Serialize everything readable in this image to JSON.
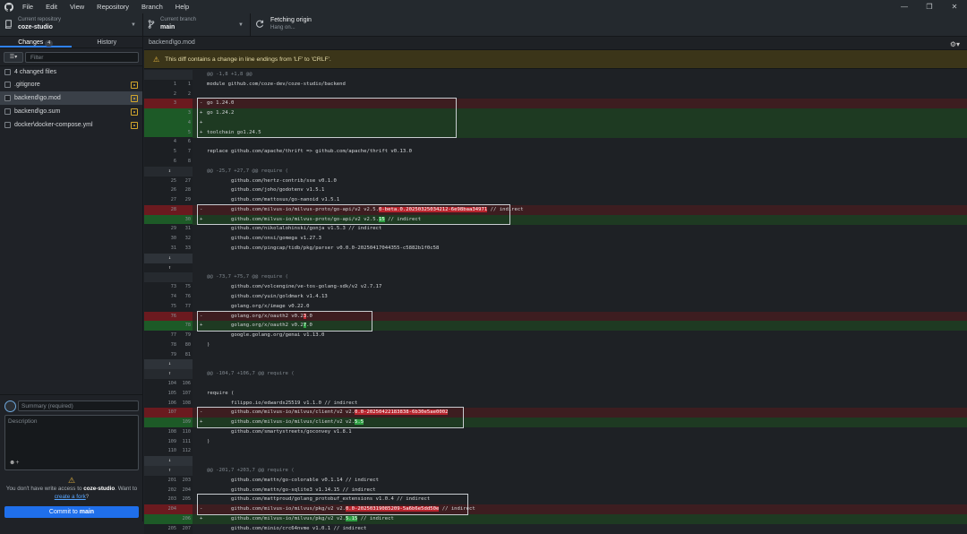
{
  "menu": [
    "File",
    "Edit",
    "View",
    "Repository",
    "Branch",
    "Help"
  ],
  "toolbar": {
    "repo_label": "Current repository",
    "repo_value": "coze-studio",
    "branch_label": "Current branch",
    "branch_value": "main",
    "fetch_label": "Fetching origin",
    "fetch_value": "Hang on..."
  },
  "sidebar": {
    "tab_changes": "Changes",
    "changes_count": "4",
    "tab_history": "History",
    "filter_placeholder": "Filter",
    "changed_files_label": "4 changed files",
    "files": [
      ".gitignore",
      "backend\\go.mod",
      "backend\\go.sum",
      "docker\\docker-compose.yml"
    ]
  },
  "commit": {
    "summary_placeholder": "Summary (required)",
    "description_placeholder": "Description",
    "warn_pre": "You don't have write access to ",
    "warn_repo": "coze-studio",
    "warn_mid": ". Want to ",
    "warn_link": "create a fork",
    "warn_post": "?",
    "button_pre": "Commit to ",
    "button_branch": "main"
  },
  "diff": {
    "path": "backend\\go.mod",
    "banner": "This diff contains a change in line endings from 'LF' to 'CRLF'.",
    "lines": [
      {
        "t": "hunk",
        "o": "",
        "n": "",
        "c": "@@ -1,8 +1,8 @@"
      },
      {
        "t": "ctx",
        "o": "1",
        "n": "1",
        "c": "module github.com/coze-dev/coze-studio/backend"
      },
      {
        "t": "ctx",
        "o": "2",
        "n": "2",
        "c": ""
      },
      {
        "t": "del",
        "o": "3",
        "n": "",
        "c": "go 1.24.0"
      },
      {
        "t": "add",
        "o": "",
        "n": "3",
        "c": "go 1.24.2"
      },
      {
        "t": "add",
        "o": "",
        "n": "4",
        "c": ""
      },
      {
        "t": "add",
        "o": "",
        "n": "5",
        "c": "toolchain go1.24.5"
      },
      {
        "t": "ctx",
        "o": "4",
        "n": "6",
        "c": ""
      },
      {
        "t": "ctx",
        "o": "5",
        "n": "7",
        "c": "replace github.com/apache/thrift => github.com/apache/thrift v0.13.0"
      },
      {
        "t": "ctx",
        "o": "6",
        "n": "8",
        "c": ""
      },
      {
        "t": "hunk",
        "o": "",
        "n": "",
        "c": "@@ -25,7 +27,7 @@ require (",
        "exp": "⇕"
      },
      {
        "t": "ctx",
        "o": "25",
        "n": "27",
        "c": "\tgithub.com/hertz-contrib/sse v0.1.0"
      },
      {
        "t": "ctx",
        "o": "26",
        "n": "28",
        "c": "\tgithub.com/joho/godotenv v1.5.1"
      },
      {
        "t": "ctx",
        "o": "27",
        "n": "29",
        "c": "\tgithub.com/mattosus/go-nanoid v1.5.1"
      },
      {
        "t": "del",
        "o": "28",
        "n": "",
        "c": "\tgithub.com/milvus-io/milvus-proto/go-api/v2 v2.5.",
        "h": "0-beta.0.20250325034212-6e98baa34971",
        "c2": " // indirect"
      },
      {
        "t": "add",
        "o": "",
        "n": "30",
        "c": "\tgithub.com/milvus-io/milvus-proto/go-api/v2 v2.5.",
        "h": "15",
        "c2": " // indirect"
      },
      {
        "t": "ctx",
        "o": "29",
        "n": "31",
        "c": "\tgithub.com/nikolalohinski/gonja v1.5.3 // indirect"
      },
      {
        "t": "ctx",
        "o": "30",
        "n": "32",
        "c": "\tgithub.com/onsi/gomega v1.27.3"
      },
      {
        "t": "ctx",
        "o": "31",
        "n": "33",
        "c": "\tgithub.com/pingcap/tidb/pkg/parser v0.0.0-20250417044355-c5882b1f0c58"
      },
      {
        "t": "exp",
        "o": "",
        "n": "",
        "c": "",
        "exp": "↓"
      },
      {
        "t": "blank",
        "o": "",
        "n": "",
        "c": "",
        "exp": "↑"
      },
      {
        "t": "hunk",
        "o": "",
        "n": "",
        "c": "@@ -73,7 +75,7 @@ require ("
      },
      {
        "t": "ctx",
        "o": "73",
        "n": "75",
        "c": "\tgithub.com/volcengine/ve-tos-golang-sdk/v2 v2.7.17"
      },
      {
        "t": "ctx",
        "o": "74",
        "n": "76",
        "c": "\tgithub.com/yuin/goldmark v1.4.13"
      },
      {
        "t": "ctx",
        "o": "75",
        "n": "77",
        "c": "\tgolang.org/x/image v0.22.0"
      },
      {
        "t": "del",
        "o": "76",
        "n": "",
        "c": "\tgolang.org/x/oauth2 v0.2",
        "h": "3",
        "c2": ".0"
      },
      {
        "t": "add",
        "o": "",
        "n": "78",
        "c": "\tgolang.org/x/oauth2 v0.2",
        "h": "7",
        "c2": ".0"
      },
      {
        "t": "ctx",
        "o": "77",
        "n": "79",
        "c": "\tgoogle.golang.org/genai v1.13.0"
      },
      {
        "t": "ctx",
        "o": "78",
        "n": "80",
        "c": ")"
      },
      {
        "t": "ctx",
        "o": "79",
        "n": "81",
        "c": ""
      },
      {
        "t": "exp",
        "o": "",
        "n": "",
        "c": "",
        "exp": "↓"
      },
      {
        "t": "hunk",
        "o": "",
        "n": "",
        "c": "@@ -104,7 +106,7 @@ require (",
        "exp": "↑"
      },
      {
        "t": "ctx",
        "o": "104",
        "n": "106",
        "c": ""
      },
      {
        "t": "ctx",
        "o": "105",
        "n": "107",
        "c": "require ("
      },
      {
        "t": "ctx",
        "o": "106",
        "n": "108",
        "c": "\tfilippo.io/edwards25519 v1.1.0 // indirect"
      },
      {
        "t": "del",
        "o": "107",
        "n": "",
        "c": "\tgithub.com/milvus-io/milvus/client/v2 v2.",
        "h": "0.0-20250422183838-6b30e5ae0002",
        "c2": ""
      },
      {
        "t": "add",
        "o": "",
        "n": "109",
        "c": "\tgithub.com/milvus-io/milvus/client/v2 v2.",
        "h": "5.5",
        "c2": ""
      },
      {
        "t": "ctx",
        "o": "108",
        "n": "110",
        "c": "\tgithub.com/smartystreets/goconvey v1.8.1"
      },
      {
        "t": "ctx",
        "o": "109",
        "n": "111",
        "c": ")"
      },
      {
        "t": "ctx",
        "o": "110",
        "n": "112",
        "c": ""
      },
      {
        "t": "exp",
        "o": "",
        "n": "",
        "c": "",
        "exp": "↓"
      },
      {
        "t": "hunk",
        "o": "",
        "n": "",
        "c": "@@ -201,7 +203,7 @@ require (",
        "exp": "↑"
      },
      {
        "t": "ctx",
        "o": "201",
        "n": "203",
        "c": "\tgithub.com/mattn/go-colorable v0.1.14 // indirect"
      },
      {
        "t": "ctx",
        "o": "202",
        "n": "204",
        "c": "\tgithub.com/mattn/go-sqlite3 v1.14.15 // indirect"
      },
      {
        "t": "ctx",
        "o": "203",
        "n": "205",
        "c": "\tgithub.com/mattproud/golang_protobuf_extensions v1.0.4 // indirect"
      },
      {
        "t": "del",
        "o": "204",
        "n": "",
        "c": "\tgithub.com/milvus-io/milvus/pkg/v2 v2.",
        "h": "0.0-20250319085209-5a6b6e5dd50e",
        "c2": " // indirect"
      },
      {
        "t": "add",
        "o": "",
        "n": "206",
        "c": "\tgithub.com/milvus-io/milvus/pkg/v2 v2.",
        "h": "5.15",
        "c2": " // indirect"
      },
      {
        "t": "ctx",
        "o": "205",
        "n": "207",
        "c": "\tgithub.com/minio/crc64nvme v1.0.1 // indirect"
      }
    ]
  },
  "colors": {
    "accent": "#1f6feb",
    "del": "#b8242d",
    "add": "#2ea043",
    "warning": "#3b3519"
  }
}
